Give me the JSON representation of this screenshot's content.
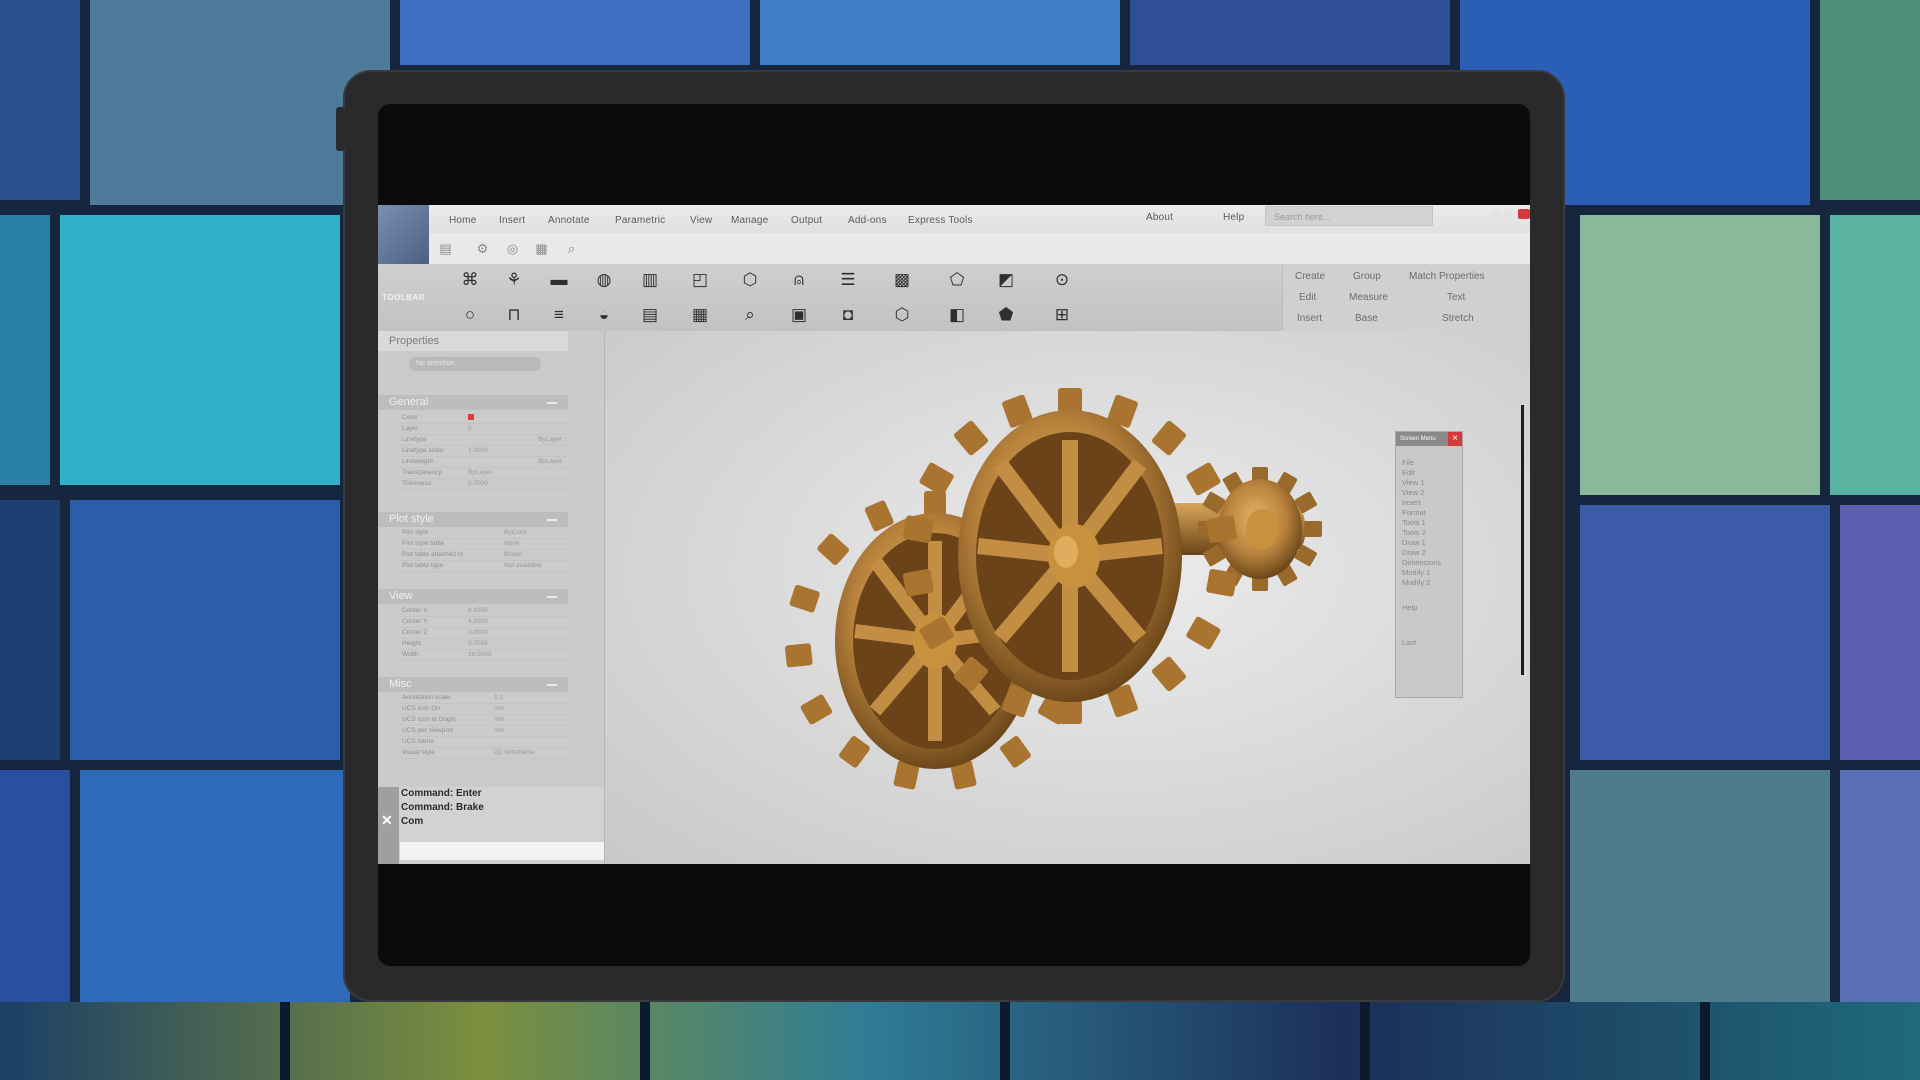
{
  "app": {
    "menu": [
      "Home",
      "Insert",
      "Annotate",
      "Parametric",
      "View",
      "Manage",
      "Output",
      "Add-ons",
      "Express Tools"
    ],
    "about_label": "About",
    "help_label": "Help",
    "search_placeholder": "Search here..."
  },
  "quick_access": [
    "layers-icon",
    "settings-icon",
    "circle-target-icon",
    "grid-icon",
    "search-icon"
  ],
  "toolbar": {
    "label": "TOOLBAR",
    "row1_icons": [
      "icon-a",
      "icon-b",
      "icon-c",
      "icon-d",
      "icon-e",
      "icon-f",
      "icon-g",
      "icon-h",
      "icon-i",
      "icon-j",
      "icon-k",
      "icon-l",
      "icon-m"
    ],
    "row2_icons": [
      "icon-n",
      "icon-o",
      "icon-p",
      "icon-q",
      "icon-r",
      "icon-s",
      "icon-t",
      "icon-u",
      "icon-v",
      "icon-w",
      "icon-x",
      "icon-y",
      "icon-z"
    ],
    "right_panel": [
      [
        "Create",
        "Group",
        "Match Properties"
      ],
      [
        "Edit",
        "Measure",
        "Text"
      ],
      [
        "Insert",
        "Base",
        "Stretch"
      ]
    ]
  },
  "properties": {
    "title": "Properties",
    "selection": "No selection",
    "general": {
      "title": "General",
      "rows": [
        {
          "k": "Color",
          "v": "",
          "v2": ""
        },
        {
          "k": "Layer",
          "v": "0",
          "v2": ""
        },
        {
          "k": "Linetype",
          "v": "",
          "v2": "ByLayer"
        },
        {
          "k": "Linetype scale",
          "v": "1.0000",
          "v2": ""
        },
        {
          "k": "Lineweight",
          "v": "",
          "v2": "ByLayer"
        },
        {
          "k": "Transparency",
          "v": "ByLayer",
          "v2": ""
        },
        {
          "k": "Thickness",
          "v": "0.0000",
          "v2": ""
        }
      ]
    },
    "plot_style": {
      "title": "Plot style",
      "rows": [
        {
          "k": "Plot style",
          "v": "ByColor"
        },
        {
          "k": "Plot style table",
          "v": "None"
        },
        {
          "k": "Plot table attached to",
          "v": "Model"
        },
        {
          "k": "Plot table type",
          "v": "Not available"
        }
      ]
    },
    "view": {
      "title": "View",
      "rows": [
        {
          "k": "Center X",
          "v": "8.4365"
        },
        {
          "k": "Center Y",
          "v": "4.5000"
        },
        {
          "k": "Center Z",
          "v": "0.0000"
        },
        {
          "k": "Height",
          "v": "9.0588"
        },
        {
          "k": "Width",
          "v": "16.5009"
        }
      ]
    },
    "misc": {
      "title": "Misc",
      "rows": [
        {
          "k": "Annotation scale",
          "v": "1:1"
        },
        {
          "k": "UCS icon On",
          "v": "Yes"
        },
        {
          "k": "UCS icon at Origin",
          "v": "Yes"
        },
        {
          "k": "UCS per viewport",
          "v": "Yes"
        },
        {
          "k": "UCS name",
          "v": ""
        },
        {
          "k": "Visual style",
          "v": "2D Wireframe"
        }
      ]
    }
  },
  "command": {
    "lines": [
      "Command: Enter",
      "Command: Brake",
      "Com"
    ]
  },
  "screen_menu": {
    "title": "Screen Menu",
    "items": [
      "File",
      "Edit",
      "View 1",
      "View 2",
      "Insert",
      "Format",
      "Tools 1",
      "Tools 2",
      "Draw 1",
      "Draw 2",
      "Dimensions",
      "Modify 1",
      "Modify 2"
    ],
    "help": "Help",
    "last": "Last"
  },
  "colors": {
    "gear": "#b8823c",
    "gear_dark": "#6a4418",
    "accent_red": "#d33b3b"
  }
}
